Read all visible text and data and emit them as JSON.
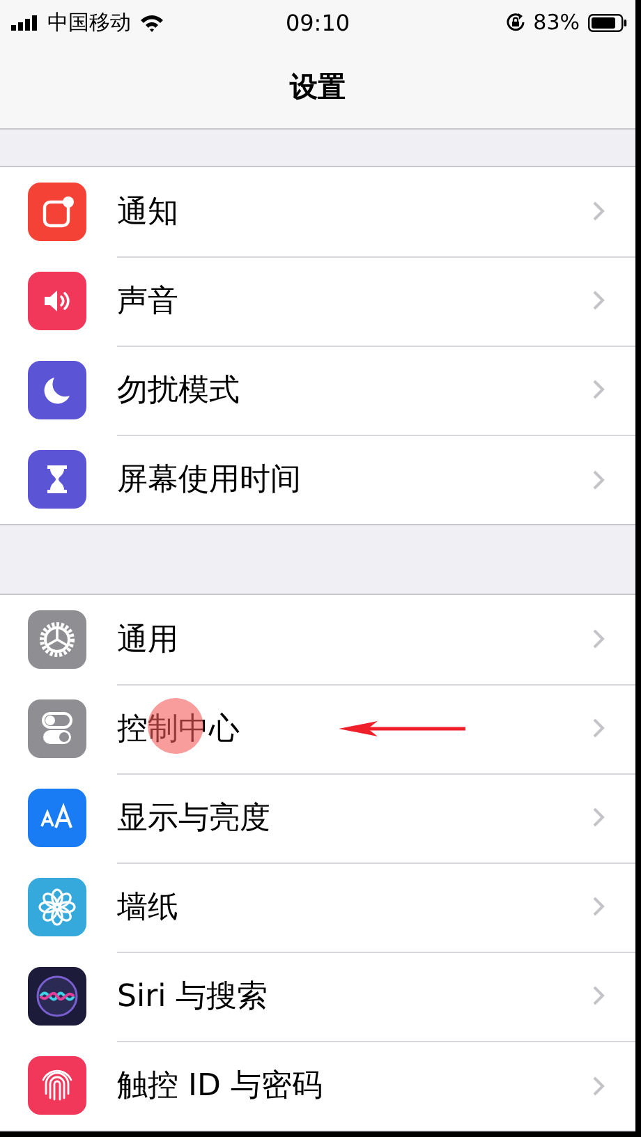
{
  "status_bar": {
    "carrier": "中国移动",
    "time": "09:10",
    "battery": "83%"
  },
  "nav_bar": {
    "title": "设置"
  },
  "groups": [
    {
      "items": [
        {
          "label": "通知",
          "kind": "notifications",
          "color": "#f44336",
          "annotated": false
        },
        {
          "label": "声音",
          "kind": "sounds",
          "color": "#f2385a",
          "annotated": false
        },
        {
          "label": "勿扰模式",
          "kind": "moon",
          "color": "#5b55d6",
          "annotated": false
        },
        {
          "label": "屏幕使用时间",
          "kind": "hourglass",
          "color": "#5b55d6",
          "annotated": false
        }
      ]
    },
    {
      "items": [
        {
          "label": "通用",
          "kind": "gear",
          "color": "#8e8e93",
          "annotated": false
        },
        {
          "label": "控制中心",
          "kind": "toggles",
          "color": "#8e8e93",
          "annotated": true
        },
        {
          "label": "显示与亮度",
          "kind": "text-size",
          "color": "#1a7cf5",
          "annotated": false
        },
        {
          "label": "墙纸",
          "kind": "flower",
          "color": "#36a9dc",
          "annotated": false
        },
        {
          "label": "Siri 与搜索",
          "kind": "siri",
          "color": "#1c1c3a",
          "annotated": false
        },
        {
          "label": "触控 ID 与密码",
          "kind": "fingerprint",
          "color": "#f2385a",
          "annotated": false
        }
      ]
    }
  ]
}
